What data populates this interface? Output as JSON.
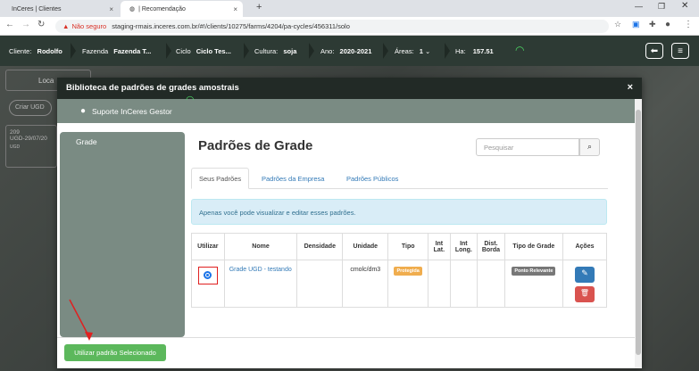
{
  "browser": {
    "tabs": [
      {
        "title": "InCeres | Clientes",
        "close": "×"
      },
      {
        "title": "| Recomendação",
        "close": "×"
      }
    ],
    "new_tab": "+",
    "not_secure": "Não seguro",
    "url": "staging-rmais.inceres.com.br/#!/clients/10275/farms/4204/pa-cycles/456311/solo"
  },
  "header": {
    "client_label": "Cliente:",
    "client_value": "Rodolfo",
    "farm_label": "Fazenda",
    "farm_value": "Fazenda T...",
    "cycle_label": "Ciclo",
    "cycle_value": "Ciclo Tes...",
    "crop_label": "Cultura:",
    "crop_value": "soja",
    "year_label": "Ano:",
    "year_value": "2020-2021",
    "areas_label": "Áreas:",
    "areas_value": "1",
    "ha_label": "Ha:",
    "ha_value": "157.51"
  },
  "background": {
    "tab": "Loca",
    "create_button": "Criar UGD",
    "card_num": "209",
    "card_date": "UGD-29/07/20",
    "card_tag": "UGD"
  },
  "modal": {
    "title": "Biblioteca de padrões de grades amostrais",
    "close": "×",
    "support": "Suporte InCeres Gestor",
    "sidebar_item": "Grade",
    "heading": "Padrões de Grade",
    "search_placeholder": "Pesquisar",
    "tabs": [
      "Seus Padrões",
      "Padrões da Empresa",
      "Padrões Públicos"
    ],
    "info": "Apenas você pode visualizar e editar esses padrões.",
    "columns": [
      "Utilizar",
      "Nome",
      "Densidade",
      "Unidade",
      "Tipo",
      "Int Lat.",
      "Int Long.",
      "Dist. Borda",
      "Tipo de Grade",
      "Ações"
    ],
    "row": {
      "name": "Grade UGD - testando",
      "density": "",
      "unit": "cmolc/dm3",
      "type_badge": "Protegida",
      "int_lat": "",
      "int_long": "",
      "dist_border": "",
      "grid_type_badge": "Ponto Relevante"
    },
    "use_button": "Utilizar padrão Selecionado"
  },
  "colors": {
    "accent": "#5cb85c",
    "header": "#2d3a34",
    "sidebar": "#7a8b83",
    "annotation": "#e02020"
  }
}
